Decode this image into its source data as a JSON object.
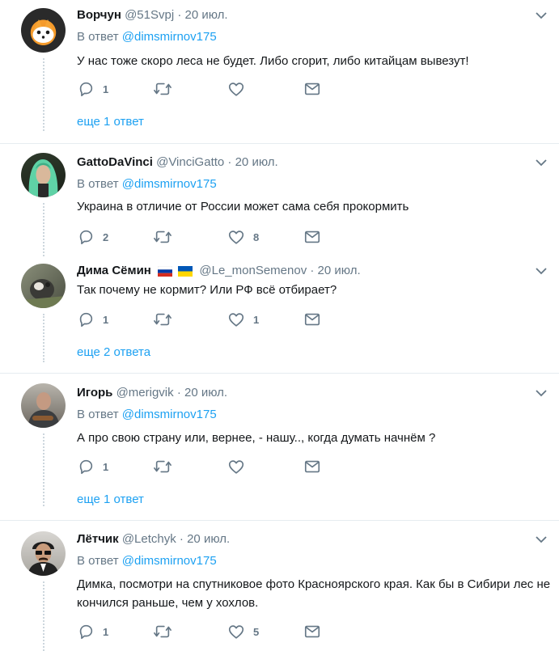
{
  "tweets": [
    {
      "name": "Ворчун",
      "handle": "@51Svpj",
      "dot": "·",
      "date": "20 июл.",
      "reply_prefix": "В ответ",
      "reply_mention": "@dimsmirnov175",
      "text": "У нас тоже скоро леса не будет. Либо сгорит, либо китайцам вывезут!",
      "reply_count": "1",
      "retweet_count": "",
      "like_count": "",
      "more_replies": "еще 1 ответ"
    },
    {
      "name": "GattoDaVinci",
      "handle": "@VinciGatto",
      "dot": "·",
      "date": "20 июл.",
      "reply_prefix": "В ответ",
      "reply_mention": "@dimsmirnov175",
      "text": "Украина в отличие от России может сама себя прокормить",
      "reply_count": "2",
      "retweet_count": "",
      "like_count": "8"
    },
    {
      "name": "Дима Сёмин",
      "handle": "@Le_monSemenov",
      "dot": "·",
      "date": "20 июл.",
      "text": "Так почему не кормит? Или РФ всё отбирает?",
      "reply_count": "1",
      "retweet_count": "",
      "like_count": "1",
      "more_replies": "еще 2 ответа"
    },
    {
      "name": "Игорь",
      "handle": "@merigvik",
      "dot": "·",
      "date": "20 июл.",
      "reply_prefix": "В ответ",
      "reply_mention": "@dimsmirnov175",
      "text": "А про свою страну или, вернее, - нашу.., когда думать начнём ?",
      "reply_count": "1",
      "retweet_count": "",
      "like_count": "",
      "more_replies": "еще 1 ответ"
    },
    {
      "name": "Лётчик",
      "handle": "@Letchyk",
      "dot": "·",
      "date": "20 июл.",
      "reply_prefix": "В ответ",
      "reply_mention": "@dimsmirnov175",
      "text": "Димка, посмотри на спутниковое фото Красноярского края. Как бы в Сибири лес не кончился раньше, чем у хохлов.",
      "reply_count": "1",
      "retweet_count": "",
      "like_count": "5"
    }
  ],
  "colors": {
    "accent": "#1da1f2",
    "muted": "#657786",
    "icon": "#657786",
    "separator": "#e6ecf0",
    "flag_ru": [
      "#ffffff",
      "#0039a6",
      "#d52b1e"
    ],
    "flag_ua": [
      "#0057b7",
      "#ffd700"
    ]
  },
  "icons": [
    "chevron-down-icon",
    "reply-icon",
    "retweet-icon",
    "like-icon",
    "message-icon",
    "flag-russia-icon",
    "flag-ukraine-icon"
  ]
}
